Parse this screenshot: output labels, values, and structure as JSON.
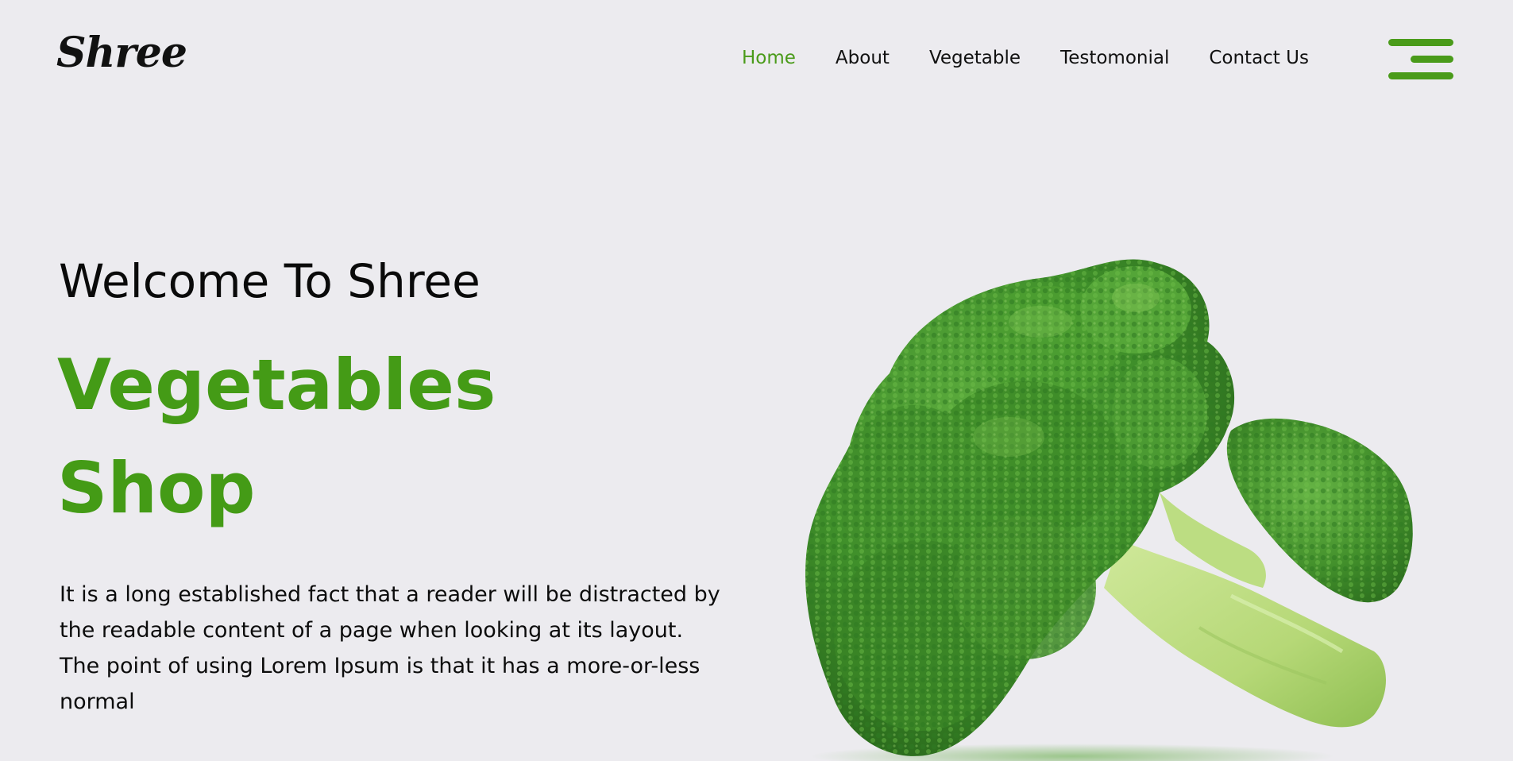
{
  "brand": {
    "logo_text": "Shree"
  },
  "nav": {
    "items": [
      {
        "label": "Home",
        "active": true
      },
      {
        "label": "About",
        "active": false
      },
      {
        "label": "Vegetable",
        "active": false
      },
      {
        "label": "Testomonial",
        "active": false
      },
      {
        "label": "Contact Us",
        "active": false
      }
    ],
    "menu_icon": "hamburger-menu-icon"
  },
  "hero": {
    "welcome": "Welcome To Shree",
    "title_line1": "Vegetables",
    "title_line2": "Shop",
    "description": "It is a long established fact that a reader will be distracted by the readable content of a page when looking at its layout. The point of using Lorem Ipsum is that it has a more-or-less normal",
    "image": "broccoli-image"
  },
  "colors": {
    "accent": "#449b16",
    "background": "#ecebef",
    "text": "#0a0a0a"
  }
}
